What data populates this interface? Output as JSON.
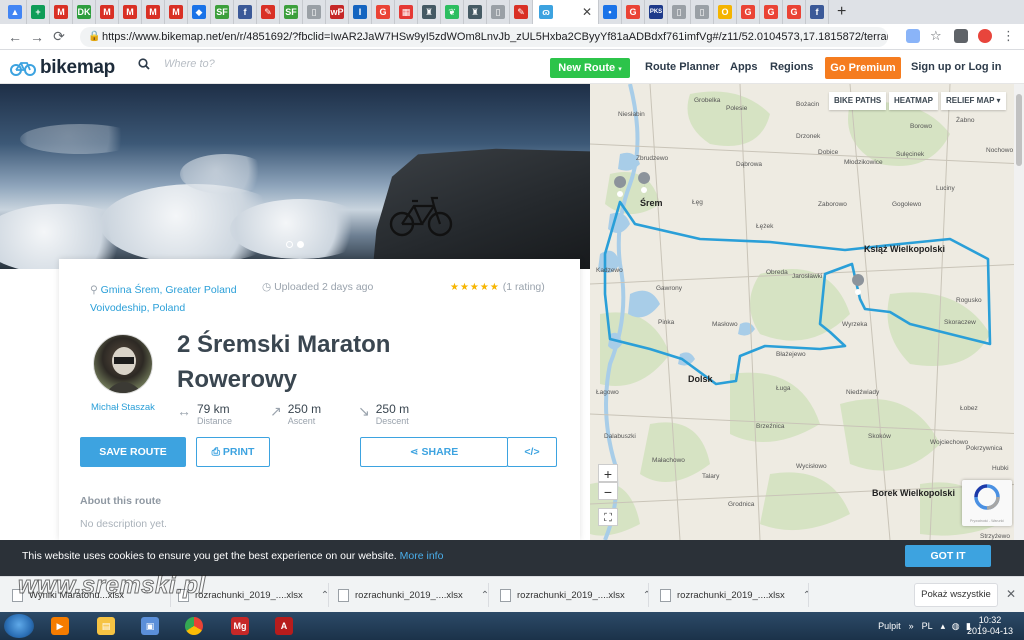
{
  "browser": {
    "tabs": [
      {
        "icon": "drive-icon",
        "color": "#4285f4",
        "glyph": "▲"
      },
      {
        "icon": "sheets-icon",
        "color": "#0f9d58",
        "glyph": "+"
      },
      {
        "icon": "gmail-icon",
        "color": "#d93025",
        "glyph": "M"
      },
      {
        "icon": "dk-icon",
        "color": "#2e9e3e",
        "glyph": "DK"
      },
      {
        "icon": "gmail-icon",
        "color": "#d93025",
        "glyph": "M"
      },
      {
        "icon": "gmail-icon",
        "color": "#d93025",
        "glyph": "M"
      },
      {
        "icon": "gmail-icon",
        "color": "#d93025",
        "glyph": "M"
      },
      {
        "icon": "gmail-icon",
        "color": "#d93025",
        "glyph": "M"
      },
      {
        "icon": "blue-icon",
        "color": "#1a73e8",
        "glyph": "◆"
      },
      {
        "icon": "sf-icon",
        "color": "#3c9f3c",
        "glyph": "SF"
      },
      {
        "icon": "facebook-icon",
        "color": "#3b5998",
        "glyph": "f"
      },
      {
        "icon": "pdf-icon",
        "color": "#d93025",
        "glyph": "✎"
      },
      {
        "icon": "sf-icon",
        "color": "#3c9f3c",
        "glyph": "SF"
      },
      {
        "icon": "doc-icon",
        "color": "#9aa0a6",
        "glyph": "▯"
      },
      {
        "icon": "wp-icon",
        "color": "#c62828",
        "glyph": "wP"
      },
      {
        "icon": "bookmark-icon",
        "color": "#1565c0",
        "glyph": "I"
      },
      {
        "icon": "google-icon",
        "color": "#ea4335",
        "glyph": "G"
      },
      {
        "icon": "grid-icon",
        "color": "#e53935",
        "glyph": "▦"
      },
      {
        "icon": "gov-icon",
        "color": "#455a64",
        "glyph": "♜"
      },
      {
        "icon": "evernote-icon",
        "color": "#2dbe60",
        "glyph": "❦"
      },
      {
        "icon": "gov-icon",
        "color": "#455a64",
        "glyph": "♜"
      },
      {
        "icon": "doc-icon",
        "color": "#9aa0a6",
        "glyph": "▯"
      },
      {
        "icon": "pdf-icon",
        "color": "#d93025",
        "glyph": "✎"
      },
      {
        "icon": "bikemap-icon",
        "color": "#3da3e0",
        "glyph": "ɷ"
      },
      {
        "icon": "dot-icon",
        "color": "#1a73e8",
        "glyph": "•"
      },
      {
        "icon": "google-icon",
        "color": "#ea4335",
        "glyph": "G"
      },
      {
        "icon": "pks-icon",
        "color": "#1e3a8a",
        "glyph": "PKS"
      },
      {
        "icon": "doc-icon",
        "color": "#9aa0a6",
        "glyph": "▯"
      },
      {
        "icon": "doc-icon",
        "color": "#9aa0a6",
        "glyph": "▯"
      },
      {
        "icon": "yellow-icon",
        "color": "#f4b400",
        "glyph": "O"
      },
      {
        "icon": "google-icon",
        "color": "#ea4335",
        "glyph": "G"
      },
      {
        "icon": "google-icon",
        "color": "#ea4335",
        "glyph": "G"
      },
      {
        "icon": "google-icon",
        "color": "#ea4335",
        "glyph": "G"
      },
      {
        "icon": "facebook-icon",
        "color": "#3b5998",
        "glyph": "f"
      }
    ],
    "url": "https://www.bikemap.net/en/r/4851692/?fbclid=IwAR2JaW7HSw9yI5zdWOm8LnvJb_zUL5Hxba2CByyYf81aADBdxf761imfVg#/z11/52.0104573,17.1815872/terrain",
    "new_tab": "+"
  },
  "site": {
    "logo": "bikemap",
    "search_placeholder": "Where to?",
    "new_route": "New Route",
    "nav": [
      "Route Planner",
      "Apps",
      "Regions"
    ],
    "premium": "Go Premium",
    "signin": "Sign up or Log in"
  },
  "route": {
    "location": "Gmina Śrem, Greater Poland Voivodeship, Poland",
    "uploaded": "Uploaded 2 days ago",
    "stars": "★★★★★",
    "rating": "(1 rating)",
    "title": "2 Śremski Maraton Rowerowy",
    "author": "Michał Staszak",
    "stats": [
      {
        "value": "79 km",
        "label": "Distance",
        "icon": "distance-icon",
        "glyph": "↔"
      },
      {
        "value": "250 m",
        "label": "Ascent",
        "icon": "ascent-icon",
        "glyph": "↗"
      },
      {
        "value": "250 m",
        "label": "Descent",
        "icon": "descent-icon",
        "glyph": "↘"
      }
    ],
    "save": "SAVE ROUTE",
    "print": "PRINT",
    "share": "SHARE",
    "embed": "</>",
    "about_heading": "About this route",
    "about_text": "No description yet."
  },
  "map": {
    "buttons": [
      "BIKE PATHS",
      "HEATMAP",
      "RELIEF MAP ▾"
    ],
    "zoom_in": "+",
    "zoom_out": "−",
    "fullscreen": "⛶",
    "recaptcha": "Prywatność - Warunki",
    "labels": [
      {
        "t": "Niesłabin",
        "bold": false
      },
      {
        "t": "Grobelka",
        "bold": false
      },
      {
        "t": "Polesie",
        "bold": false
      },
      {
        "t": "Bożacin",
        "bold": false
      },
      {
        "t": "Borowo",
        "bold": false
      },
      {
        "t": "Żabno",
        "bold": false
      },
      {
        "t": "Drzonek",
        "bold": false
      },
      {
        "t": "Nochowo",
        "bold": false
      },
      {
        "t": "Zbrudzewo",
        "bold": false
      },
      {
        "t": "Dąbrowa",
        "bold": false
      },
      {
        "t": "Dobice",
        "bold": false
      },
      {
        "t": "Młodzikowice",
        "bold": false
      },
      {
        "t": "Sulęcinek",
        "bold": false
      },
      {
        "t": "Śrem",
        "bold": true
      },
      {
        "t": "Łęg",
        "bold": false
      },
      {
        "t": "Zaborowo",
        "bold": false
      },
      {
        "t": "Gogolewo",
        "bold": false
      },
      {
        "t": "Luciny",
        "bold": false
      },
      {
        "t": "Łężek",
        "bold": false
      },
      {
        "t": "Książ Wielkopolski",
        "bold": true
      },
      {
        "t": "Obreda",
        "bold": false
      },
      {
        "t": "Jarosławki",
        "bold": false
      },
      {
        "t": "Rogusko",
        "bold": false
      },
      {
        "t": "Gawrony",
        "bold": false
      },
      {
        "t": "Kadzewo",
        "bold": false
      },
      {
        "t": "Pinka",
        "bold": false
      },
      {
        "t": "Masłowo",
        "bold": false
      },
      {
        "t": "Skoraczew",
        "bold": false
      },
      {
        "t": "Wyrzeka",
        "bold": false
      },
      {
        "t": "Błażejewo",
        "bold": false
      },
      {
        "t": "Dolsk",
        "bold": true
      },
      {
        "t": "Łagowo",
        "bold": false
      },
      {
        "t": "Ługa",
        "bold": false
      },
      {
        "t": "Niedźwiady",
        "bold": false
      },
      {
        "t": "Łobez",
        "bold": false
      },
      {
        "t": "Dalabuszki",
        "bold": false
      },
      {
        "t": "Małachowo",
        "bold": false
      },
      {
        "t": "Brzeźnica",
        "bold": false
      },
      {
        "t": "Skoków",
        "bold": false
      },
      {
        "t": "Wycisłowo",
        "bold": false
      },
      {
        "t": "Wojciechowo",
        "bold": false
      },
      {
        "t": "Pokrzywnica",
        "bold": false
      },
      {
        "t": "Talary",
        "bold": false
      },
      {
        "t": "Hubki",
        "bold": false
      },
      {
        "t": "Grodnica",
        "bold": false
      },
      {
        "t": "Borek Wielkopolski",
        "bold": true
      },
      {
        "t": "Strzyżewo",
        "bold": false
      }
    ],
    "route_color": "#2a9fd8"
  },
  "cookie": {
    "message": "This website uses cookies to ensure you get the best experience on our website.",
    "more": "More info",
    "button": "GOT IT"
  },
  "downloads": {
    "items": [
      "Wyniki Maratonu...xlsx",
      "rozrachunki_2019_....xlsx",
      "rozrachunki_2019_....xlsx",
      "rozrachunki_2019_....xlsx",
      "rozrachunki_2019_....xlsx"
    ],
    "show_all": "Pokaż wszystkie",
    "close": "✕"
  },
  "taskbar": {
    "pulpit": "Pulpit",
    "lang": "PL",
    "time": "10:32",
    "date": "2019-04-13"
  },
  "watermark": "www.sremski.pl"
}
